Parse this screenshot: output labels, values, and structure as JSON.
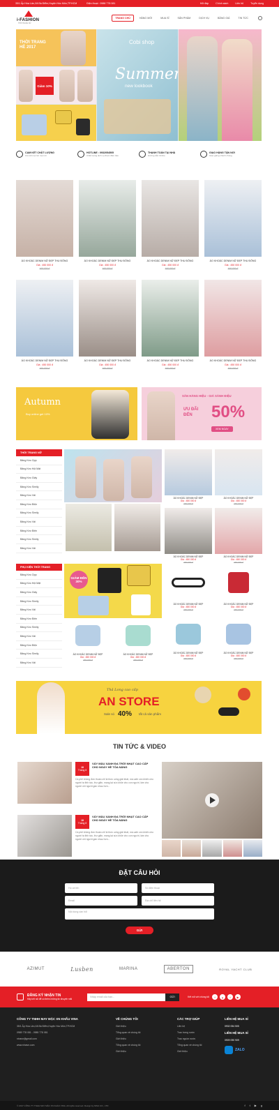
{
  "topbar": {
    "address": "35/1 Ấp Hòa Lân,Xã Bà Điểm,Huyện Hóc Môn,TP.HCM",
    "phone": "Điện thoại : 0988 778 081",
    "links": [
      "Hỏi đáp",
      "Chính sách",
      "Liên hệ",
      "Tuyển dụng"
    ]
  },
  "logo": {
    "name": "i-FASHION",
    "tagline": "THỜI TRANG NỮ"
  },
  "nav": [
    "TRANG CHỦ",
    "HÀNG MỚI",
    "MUA SỈ",
    "SẢN PHẨM",
    "DỊCH VỤ",
    "BẢNG GIÁ",
    "TIN TỨC"
  ],
  "hero": {
    "promo1": "THỜI TRANG HÈ 2017",
    "promo2": "Giảm 10%",
    "brand": "Cobi shop",
    "title": "Summer",
    "subtitle": "new lookbook"
  },
  "features": [
    {
      "title": "CAM KẾT CHẤT LƯỢNG",
      "sub": "Cá mết mọi lúc mọi nơi",
      "icon": "quality-icon"
    },
    {
      "title": "HOTLINE : 0932054505",
      "sub": "Chất lượng dịch vụ được đảm bảo",
      "icon": "hotline-icon"
    },
    {
      "title": "THANH TOÁN TẠI NHÀ",
      "sub": "Hướng dẫn Online",
      "icon": "payment-icon"
    },
    {
      "title": "GIAO HÀNG TẬN NƠI",
      "sub": "Giao giàng nhanh chóng",
      "icon": "delivery-icon"
    }
  ],
  "products": [
    {
      "name": "ÁO KHOÁC DENIM NỮ ĐẸP THU ĐÔNG",
      "price": "Giá : 450 000 đ",
      "old": "460 000 đ"
    },
    {
      "name": "ÁO KHOÁC DENIM NỮ ĐẸP THU ĐÔNG",
      "price": "Giá : 450 000 đ",
      "old": "460 000 đ"
    },
    {
      "name": "ÁO KHOÁC DENIM NỮ ĐẸP THU ĐÔNG",
      "price": "Giá : 450 000 đ",
      "old": "460 000 đ"
    },
    {
      "name": "ÁO KHOÁC DENIM NỮ ĐẸP THU ĐÔNG",
      "price": "Giá : 450 000 đ",
      "old": "460 000 đ"
    },
    {
      "name": "ÁO KHOÁC DENIM NỮ ĐẸP THU ĐÔNG",
      "price": "Giá : 450 000 đ",
      "old": "460 000 đ"
    },
    {
      "name": "ÁO KHOÁC DENIM NỮ ĐẸP THU ĐÔNG",
      "price": "Giá : 450 000 đ",
      "old": "460 000 đ"
    },
    {
      "name": "ÁO KHOÁC DENIM NỮ ĐẸP THU ĐÔNG",
      "price": "Giá : 450 000 đ",
      "old": "460 000 đ"
    },
    {
      "name": "ÁO KHOÁC DENIM NỮ ĐẸP THU ĐÔNG",
      "price": "Giá : 450 000 đ",
      "old": "460 000 đ"
    }
  ],
  "banners": {
    "autumn": "Autumn",
    "autumn_sub": "Buy online get 10%",
    "sale_title": "SĂN HÀNG HIỆU - GIÁ SÀNH ĐIỆU",
    "sale_pre": "ƯU ĐÃI ĐẾN",
    "sale_pct": "50%",
    "sale_btn": "XEM NGAY"
  },
  "cat1": {
    "title": "THỜI TRANG NỮ",
    "items": [
      "Băng Keo Opp",
      "Băng Keo Hội Mật",
      "Băng Keo Giấy",
      "Băng Keo Simily",
      "Băng Keo Vải",
      "Băng Keo Điện",
      "Băng Keo Simily",
      "Băng Keo Vải",
      "Băng Keo Điện",
      "Băng Keo Simily",
      "Băng Keo Vải"
    ]
  },
  "cat2": {
    "title": "PHỤ KIỆN THỜI TRANG",
    "items": [
      "Băng Keo Opp",
      "Băng Keo Hội Mật",
      "Băng Keo Giấy",
      "Băng Keo Simily",
      "Băng Keo Vải",
      "Băng Keo Điện",
      "Băng Keo Simily",
      "Băng Keo Vải",
      "Băng Keo Điện",
      "Băng Keo Simily",
      "Băng Keo Vải"
    ]
  },
  "small": {
    "name": "ÁO KHOÁC DENIM NỮ ĐẸP",
    "price": "Giá : 450 000 đ",
    "old": "460 000 đ"
  },
  "discount_badge": "GIẢM ĐẾN 30%",
  "store": {
    "script": "Thả Long cao cấp",
    "name": "AN STORE",
    "pre": "Sale só",
    "pct": "40%",
    "post": "tất cả sản phẩm"
  },
  "news_section": "TIN TỨC & VIDEO",
  "news": [
    {
      "day": "18",
      "month": "Tháng 8",
      "title": "VÁY MÀU XANH ĐA TRỜI NHẠT CAO CẤP CHO NGÀY HÈ TỎA NẮNG",
      "desc": "Cá phê không đơn thuần chỉ là thức uống giải khát, mà cafe còn khiến cho người ta tỉnh táo, thư giãn, mang lại sức khỏe cho con người, làm cho người với người gần nhau hơn..."
    },
    {
      "day": "18",
      "month": "Tháng 8",
      "title": "VÁY MÀU XANH ĐA TRỜI NHẠT CAO CẤP CHO NGÀY HÈ TỎA NẮNG",
      "desc": "Cá phê không đơn thuần chỉ là thức uống giải khát, mà cafe còn khiến cho người ta tỉnh táo, thư giãn, mang lại sức khỏe cho con người, làm cho người với người gần nhau hơn..."
    }
  ],
  "form": {
    "title": "ĐẶT CÂU HỎI",
    "name": "Họ và tên",
    "phone": "Số điện thoại",
    "email": "Email",
    "address": "Địa chỉ liên hệ",
    "content": "Nội dung cần hỏi",
    "submit": "GỬI"
  },
  "brands": [
    "AZIMUT",
    "Lusben",
    "MARINA",
    "ABERTON",
    "ROYAL YACHT CLUB"
  ],
  "newsletter": {
    "title": "ĐĂNG KÝ NHẬN TIN",
    "sub": "Hãy kết nối để có thêm những tin khuyến mãi",
    "placeholder": "Nhập email của bạn...",
    "button": "GỬI",
    "follow": "Kết nối với chúng tôi"
  },
  "footer": {
    "company": "CÔNG TY TNHH MAY MẶC XN KHẨU VINA",
    "info": [
      "35/1 Ấp Hòa Lân,Xã Bà Điểm,Huyện Hóc Môn,TP.HCM",
      "0989 778 081 - 0985 778 081",
      "ninavn@gmail.com",
      "www.ninavn.com"
    ],
    "col1_title": "VỀ CHÚNG TÔI",
    "col1": [
      "Giới thiệu",
      "Tổng quan về chúng tôi",
      "Giới thiệu",
      "Tổng quan về chúng tôi",
      "Giới thiệu"
    ],
    "col2_title": "CÁC TRỢ GIÚP",
    "col2": [
      "Liên hệ",
      "Trao trưng nước",
      "Trao nguồn nước",
      "Tổng quan về chúng tôi",
      "Giới thiệu"
    ],
    "col3_title": "LIÊN HỆ MUA SỈ",
    "col3_phone": "0932 054 505",
    "col4_title": "LIÊN HỆ MUA SỈ",
    "col4_phone": "0909 090 909",
    "zalo": "ZALO"
  },
  "copyright": "© 2017 CÔNG TY TNHH MAY MẶC XN KHẨU VINA. All rights reserved. Design by NINA CO., LTD"
}
